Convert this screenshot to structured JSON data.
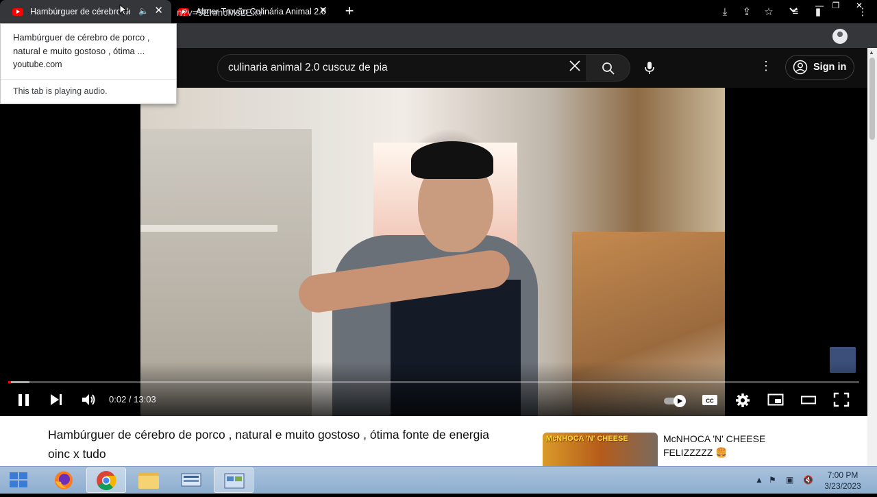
{
  "browser": {
    "tabs": [
      {
        "title": "Hambúrguer de cérebro de porco",
        "active": true
      },
      {
        "title": "Abner Trovão Culinária Animal 2.0",
        "active": false
      }
    ],
    "url": "n?v=9EhmcMs2ExY"
  },
  "hover_card": {
    "title": "Hambúrguer de cérebro de porco , natural e muito gostoso , ótima ...",
    "domain": "youtube.com",
    "audio_status": "This tab is playing audio."
  },
  "youtube": {
    "search_query": "culinaria animal 2.0 cuscuz de pia",
    "signin_label": "Sign in"
  },
  "player": {
    "timecode": "0:02 / 13:03",
    "played_fraction": 0.003,
    "buffered_fraction": 0.025
  },
  "video": {
    "title": "Hambúrguer de cérebro de porco , natural e muito gostoso , ótima fonte de energia oinc x tudo"
  },
  "recommendation": {
    "thumb_text": "McNHOCA 'N' CHEESE",
    "title": "McNHOCA 'N' CHEESE FELIZZZZZ 🍔"
  },
  "taskbar": {
    "time": "7:00 PM",
    "date": "3/23/2023"
  },
  "colors": {
    "youtube_red": "#ff0000",
    "chrome_toolbar": "#35363a",
    "yt_dark": "#0f0f0f",
    "taskbar": "#a9c2dd"
  }
}
